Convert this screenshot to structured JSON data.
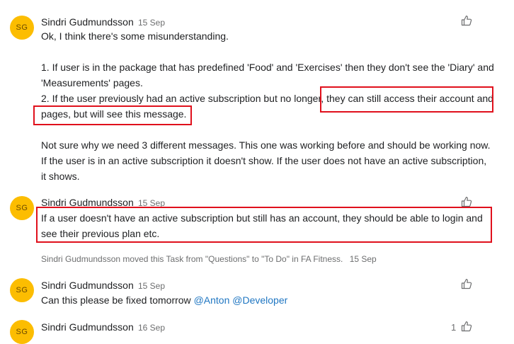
{
  "comments": [
    {
      "avatar": "SG",
      "author": "Sindri Gudmundsson",
      "date": "15 Sep",
      "lines": [
        "Ok, I think there's some misunderstanding.",
        "",
        "1. If user is in the package that has predefined 'Food' and 'Exercises' then they don't see the 'Diary' and",
        "'Measurements' pages.",
        "2. If the user previously had an active subscription but no longer, they can still access their account and",
        "pages, but will see this message.",
        "",
        "Not sure why we need 3 different messages. This one was working before and should be working now.",
        "If the user is in an active subscription it doesn't show. If the user does not have an active subscription,",
        "it shows."
      ]
    },
    {
      "avatar": "SG",
      "author": "Sindri Gudmundsson",
      "date": "15 Sep",
      "lines": [
        "If a user doesn't have an active subscription but still has an account, they should be able to login and",
        "see their previous plan etc."
      ]
    },
    {
      "avatar": "SG",
      "author": "Sindri Gudmundsson",
      "date": "15 Sep",
      "text_prefix": "Can this please be fixed tomorrow ",
      "mentions": [
        "@Anton",
        "@Developer"
      ]
    },
    {
      "avatar": "SG",
      "author": "Sindri Gudmundsson",
      "date": "16 Sep",
      "like_count": "1"
    }
  ],
  "activity": {
    "text": "Sindri Gudmundsson moved this Task from \"Questions\" to \"To Do\" in FA Fitness.",
    "date": "15 Sep"
  },
  "colors": {
    "avatar_bg": "#fcbd01",
    "highlight": "#e0101c",
    "mention": "#1f76c2",
    "muted": "#6d6e6f"
  },
  "icons": {
    "like": "thumbs-up-icon"
  }
}
